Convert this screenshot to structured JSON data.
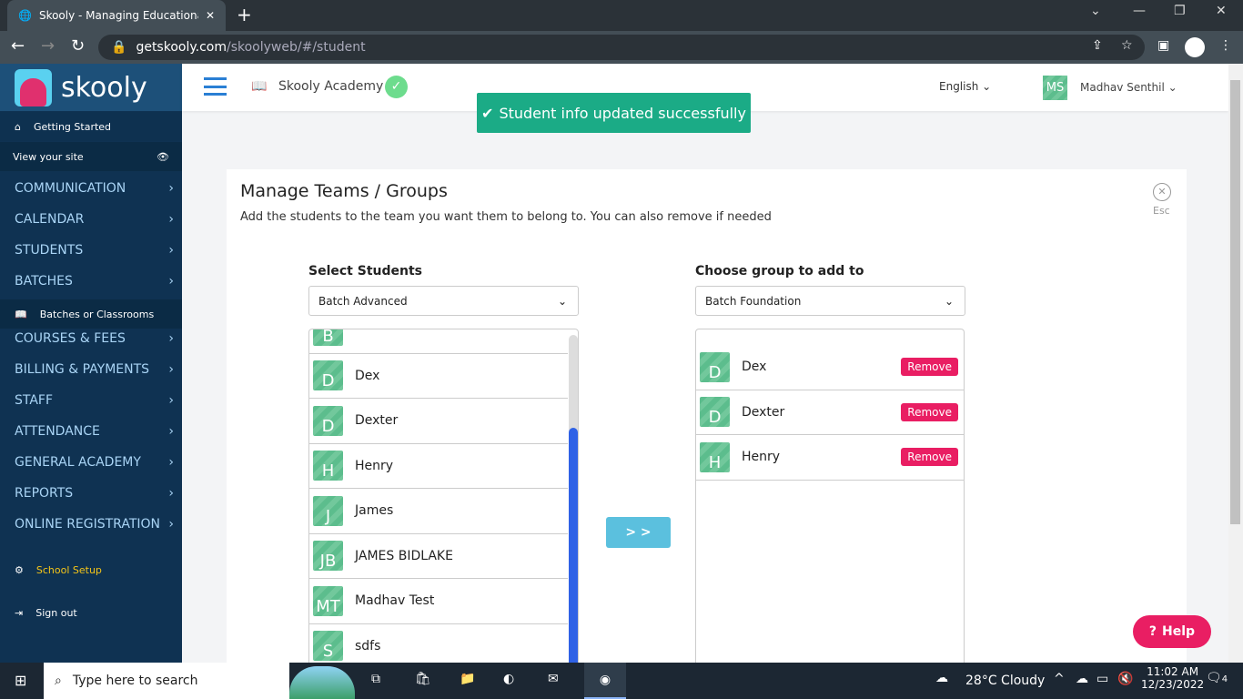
{
  "browser": {
    "tab_title": "Skooly - Managing Educational J",
    "url_host": "getskooly.com",
    "url_path": "/skoolyweb/#/student"
  },
  "sidebar": {
    "logo": "skooly",
    "getting_started": "Getting Started",
    "view_site": "View your site",
    "items": [
      {
        "label": "COMMUNICATION"
      },
      {
        "label": "CALENDAR"
      },
      {
        "label": "STUDENTS"
      },
      {
        "label": "BATCHES"
      }
    ],
    "batches_sub": "Batches or Classrooms",
    "items2": [
      {
        "label": "COURSES & FEES"
      },
      {
        "label": "BILLING & PAYMENTS"
      },
      {
        "label": "STAFF"
      },
      {
        "label": "ATTENDANCE"
      },
      {
        "label": "GENERAL ACADEMY"
      },
      {
        "label": "REPORTS"
      },
      {
        "label": "ONLINE REGISTRATION"
      }
    ],
    "school_setup": "School Setup",
    "sign_out": "Sign out"
  },
  "header": {
    "academy": "Skooly Academy",
    "language": "English",
    "user_initials": "MS",
    "user_name": "Madhav Senthil"
  },
  "toast": "Student info updated successfully",
  "modal": {
    "title": "Manage Teams / Groups",
    "subtitle": "Add the students to the team you want them to belong to. You can also remove if needed",
    "esc": "Esc",
    "select_label": "Select Students",
    "select_value": "Batch Advanced",
    "group_label": "Choose group to add to",
    "group_value": "Batch Foundation",
    "transfer_button": "> >",
    "students": [
      {
        "i": "B",
        "n": ""
      },
      {
        "i": "D",
        "n": "Dex"
      },
      {
        "i": "D",
        "n": "Dexter"
      },
      {
        "i": "H",
        "n": "Henry"
      },
      {
        "i": "J",
        "n": "James"
      },
      {
        "i": "JB",
        "n": "JAMES BIDLAKE"
      },
      {
        "i": "MT",
        "n": "Madhav Test"
      },
      {
        "i": "S",
        "n": "sdfs"
      }
    ],
    "group_members": [
      {
        "i": "D",
        "n": "Dex"
      },
      {
        "i": "D",
        "n": "Dexter"
      },
      {
        "i": "H",
        "n": "Henry"
      }
    ],
    "remove_label": "Remove"
  },
  "help": "Help",
  "taskbar": {
    "search": "Type here to search",
    "weather": "28°C  Cloudy",
    "time": "11:02 AM",
    "date": "12/23/2022",
    "notifications": "4"
  },
  "colors": {
    "sidebar": "#0f3252",
    "accent": "#1bab86",
    "remove": "#e91e63",
    "transfer": "#5bc0de"
  }
}
